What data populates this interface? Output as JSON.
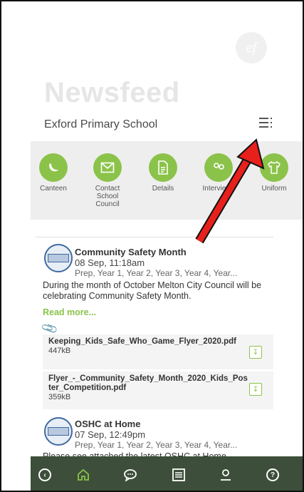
{
  "header": {
    "logo_text": "ef",
    "title": "Newsfeed",
    "school": "Exford Primary School"
  },
  "quick_actions": [
    {
      "label": "Canteen",
      "icon": "canteen-icon"
    },
    {
      "label": "Contact School Council",
      "icon": "mail-icon"
    },
    {
      "label": "Details",
      "icon": "document-icon"
    },
    {
      "label": "Interviews",
      "icon": "interviews-icon"
    },
    {
      "label": "Uniform",
      "icon": "uniform-icon"
    }
  ],
  "posts": [
    {
      "title": "Community Safety Month",
      "time": "08 Sep, 11:18am",
      "audience": "Prep, Year 1, Year 2, Year 3, Year 4, Year...",
      "body": "During the month of October Melton City Council will be celebrating Community Safety Month.",
      "read_more": "Read more...",
      "attachments": [
        {
          "name": "Keeping_Kids_Safe_Who_Game_Flyer_2020.pdf",
          "size": "447kB"
        },
        {
          "name": "Flyer_-_Community_Safety_Month_2020_Kids_Poster_Competition.pdf",
          "size": "359kB"
        }
      ]
    },
    {
      "title": "OSHC at Home",
      "time": "07 Sep, 12:49pm",
      "audience": "Prep, Year 1, Year 2, Year 3, Year 4, Year...",
      "body": "Please see attached the latest OSHC at Home"
    }
  ],
  "bottom_nav": [
    {
      "icon": "back-icon"
    },
    {
      "icon": "home-icon",
      "active": true
    },
    {
      "icon": "chat-icon"
    },
    {
      "icon": "list-icon"
    },
    {
      "icon": "profile-icon"
    },
    {
      "icon": "help-icon"
    }
  ],
  "colors": {
    "accent": "#8bc34a",
    "bottom_bar": "#3d4f3a",
    "annotation_arrow": "#e8201c"
  }
}
